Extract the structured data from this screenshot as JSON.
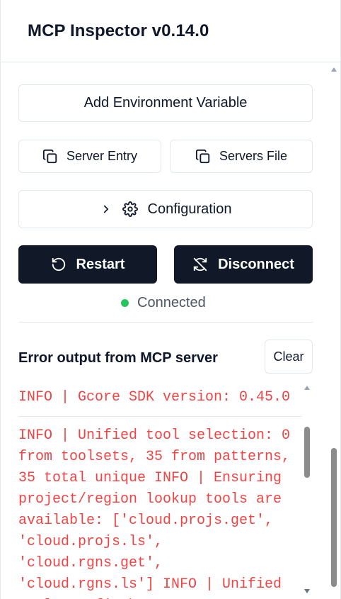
{
  "header": {
    "title": "MCP Inspector v0.14.0"
  },
  "buttons": {
    "add_env": "Add Environment Variable",
    "server_entry": "Server Entry",
    "servers_file": "Servers File",
    "configuration": "Configuration",
    "restart": "Restart",
    "disconnect": "Disconnect",
    "clear": "Clear"
  },
  "status": {
    "text": "Connected",
    "color": "#22c55e"
  },
  "error_output": {
    "title": "Error output from MCP server",
    "entries": [
      "INFO | Gcore SDK version: 0.45.0",
      "INFO | Unified tool selection: 0 from toolsets, 35 from patterns, 35 total unique INFO | Ensuring project/region lookup tools are available: ['cloud.projs.get', 'cloud.projs.ls', 'cloud.rgns.get', 'cloud.rgns.ls'] INFO | Unified tools config \\u2192"
    ]
  },
  "icons": {
    "copy": "copy-icon",
    "chevron": "chevron-right-icon",
    "gear": "gear-icon",
    "restart": "rotate-ccw-icon",
    "disconnect": "refresh-off-icon"
  },
  "colors": {
    "accent_dark": "#111827",
    "error_text": "#ef4444"
  }
}
